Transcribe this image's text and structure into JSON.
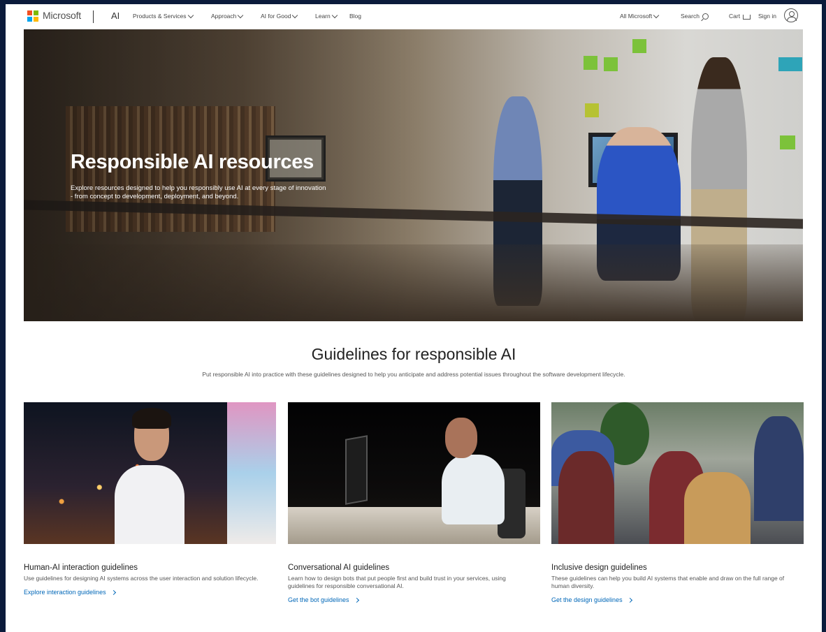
{
  "header": {
    "brand": "Microsoft",
    "section": "AI",
    "nav": [
      "Products & Services",
      "Approach",
      "AI for Good",
      "Learn"
    ],
    "blog": "Blog",
    "all_microsoft": "All Microsoft",
    "search": "Search",
    "cart": "Cart",
    "sign_in": "Sign in"
  },
  "hero": {
    "title": "Responsible AI resources",
    "description": "Explore resources designed to help you responsibly use AI at every stage of innovation - from concept to development, deployment, and beyond."
  },
  "guidelines": {
    "title": "Guidelines for responsible AI",
    "subtitle": "Put responsible AI into practice with these guidelines designed to help you anticipate and address potential issues throughout the software development lifecycle.",
    "cards": [
      {
        "title": "Human-AI interaction guidelines",
        "description": "Use guidelines for designing AI systems across the user interaction and solution lifecycle.",
        "link": "Explore interaction guidelines"
      },
      {
        "title": "Conversational AI guidelines",
        "description": "Learn how to design bots that put people first and build trust in your services, using guidelines for responsible conversational AI.",
        "link": "Get the bot guidelines"
      },
      {
        "title": "Inclusive design guidelines",
        "description": "These guidelines can help you build AI systems that enable and draw on the full range of human diversity.",
        "link": "Get the design guidelines"
      }
    ]
  },
  "icons": {
    "logo_colors": [
      "#f25022",
      "#7fba00",
      "#00a4ef",
      "#ffb900"
    ],
    "link_color": "#0067b8"
  }
}
